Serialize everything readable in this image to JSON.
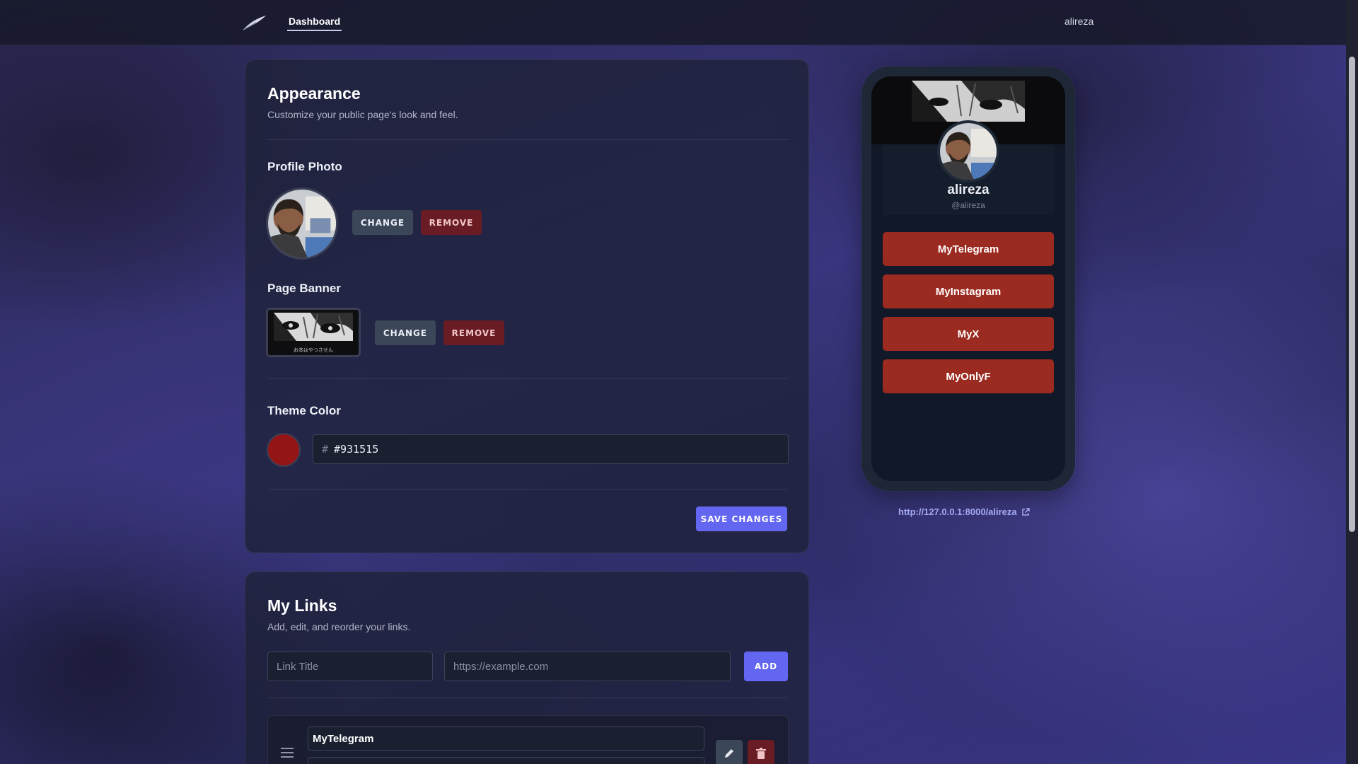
{
  "app": {
    "brand_icon": "feather-icon"
  },
  "topbar": {
    "nav_tab": "Dashboard",
    "user": "alireza"
  },
  "appearance": {
    "title": "Appearance",
    "subtitle": "Customize your public page's look and feel.",
    "profile_photo": {
      "label": "Profile Photo",
      "change": "CHANGE",
      "remove": "REMOVE"
    },
    "page_banner": {
      "label": "Page Banner",
      "change": "CHANGE",
      "remove": "REMOVE",
      "banner_text": "お本はやつさせん"
    },
    "theme_color": {
      "label": "Theme Color",
      "hash": "#",
      "value": "#931515",
      "color": "#931515"
    },
    "save": "SAVE CHANGES"
  },
  "links": {
    "title": "My Links",
    "subtitle": "Add, edit, and reorder your links.",
    "title_placeholder": "Link Title",
    "url_placeholder": "https://example.com",
    "add": "ADD",
    "items": [
      {
        "title": "MyTelegram"
      }
    ]
  },
  "preview": {
    "name": "alireza",
    "handle": "@alireza",
    "links": [
      "MyTelegram",
      "MyInstagram",
      "MyX",
      "MyOnlyF"
    ],
    "url": "http://127.0.0.1:8000/alireza",
    "button_color": "#9b2a20"
  }
}
